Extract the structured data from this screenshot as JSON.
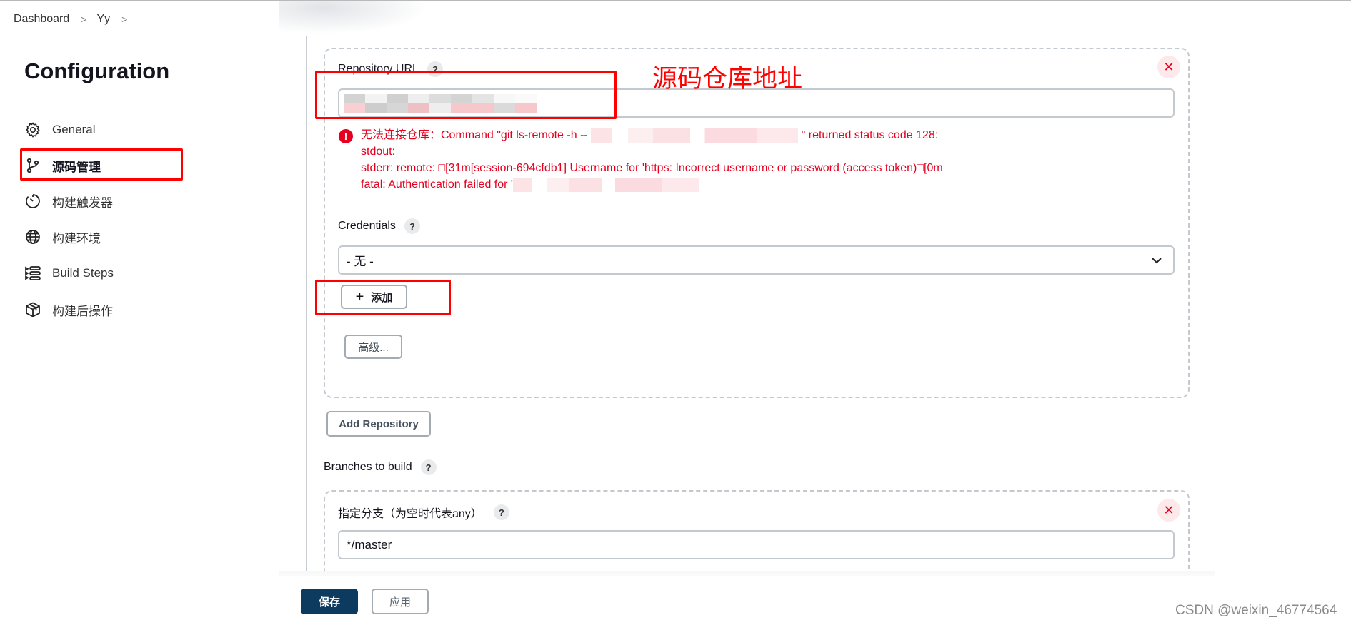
{
  "breadcrumb": {
    "items": [
      "Dashboard",
      "Yy"
    ],
    "separator": ">"
  },
  "page": {
    "title": "Configuration"
  },
  "sidebar": {
    "items": [
      {
        "label": "General",
        "icon": "gear-icon",
        "active": false
      },
      {
        "label": "源码管理",
        "icon": "git-branch-icon",
        "active": true
      },
      {
        "label": "构建触发器",
        "icon": "timer-icon",
        "active": false
      },
      {
        "label": "构建环境",
        "icon": "globe-icon",
        "active": false
      },
      {
        "label": "Build Steps",
        "icon": "list-steps-icon",
        "active": false
      },
      {
        "label": "构建后操作",
        "icon": "package-icon",
        "active": false
      }
    ]
  },
  "annotations": {
    "repo_url_note": "源码仓库地址",
    "color": "#ff0000"
  },
  "repository": {
    "url_label": "Repository URL",
    "help": "?",
    "url_value": "",
    "close": "✕",
    "error": {
      "icon": "!",
      "line1_prefix": "无法连接仓库：Command \"git ls-remote -h -- ",
      "line1_suffix": " \" returned status code 128:",
      "line2": "stdout:",
      "line3": "stderr: remote: □[31m[session-694cfdb1] Username for 'https: Incorrect username or password (access token)□[0m",
      "line4_prefix": "fatal: Authentication failed for '"
    },
    "credentials_label": "Credentials",
    "credentials_selected": "- 无 -",
    "add_button": "添加",
    "add_icon": "+",
    "advanced_button": "高级..."
  },
  "add_repository_button": "Add Repository",
  "branches": {
    "label": "Branches to build",
    "help": "?",
    "spec_label": "指定分支（为空时代表any）",
    "spec_value": "*/master",
    "close": "✕"
  },
  "footer": {
    "save": "保存",
    "apply": "应用"
  },
  "watermark": "CSDN @weixin_46774564",
  "colors": {
    "error": "#e6001f",
    "primary": "#0d3b5f",
    "annotation": "#ff0000"
  }
}
